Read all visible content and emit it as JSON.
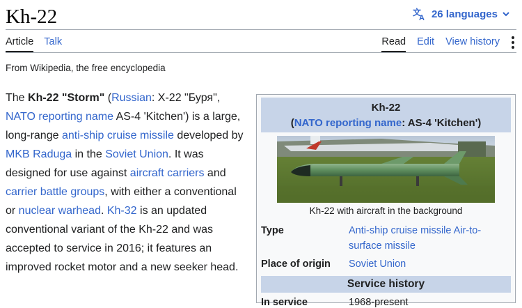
{
  "page": {
    "title": "Kh-22",
    "languages_label": "26 languages",
    "tagline": "From Wikipedia, the free encyclopedia"
  },
  "tabs": {
    "article": "Article",
    "talk": "Talk",
    "read": "Read",
    "edit": "Edit",
    "view_history": "View history"
  },
  "lead": {
    "s1": "The ",
    "b1": "Kh-22 \"Storm\"",
    "s2": " (",
    "l_russian": "Russian",
    "s3": ": Х-22 \"Буря\", ",
    "l_nato": "NATO reporting name",
    "s4": " AS-4 'Kitchen') is a large, long-range ",
    "l_ascm": "anti-ship cruise missile",
    "s5": " developed by ",
    "l_mkb": "MKB Raduga",
    "s6": " in the ",
    "l_soviet": "Soviet Union",
    "s7": ". It was designed for use against ",
    "l_carriers": "aircraft carriers",
    "s8": " and ",
    "l_cbg": "carrier battle groups",
    "s9": ", with either a conventional or ",
    "l_nuke": "nuclear warhead",
    "s10": ". ",
    "l_kh32": "Kh-32",
    "s11": " is an updated conventional variant of the Kh-22 and was accepted to service in 2016; it features an improved rocket motor and a new seeker head."
  },
  "infobox": {
    "title": "Kh-22",
    "sub_open": "(",
    "sub_link": "NATO reporting name",
    "sub_rest": ": AS-4 'Kitchen')",
    "caption": "Kh-22 with aircraft in the background",
    "type_label": "Type",
    "type_value": "Anti-ship cruise missile Air-to-surface missile",
    "origin_label": "Place of origin",
    "origin_value": "Soviet Union",
    "section_service": "Service history",
    "in_service_label": "In service",
    "in_service_value": "1968-present"
  },
  "colors": {
    "link": "#3366cc",
    "header_bg": "#c7d4e8",
    "infobox_bg": "#f8f9fa",
    "border": "#a2a9b1"
  },
  "icons": {
    "languages": "translate-icon",
    "more": "kebab-menu-icon"
  }
}
